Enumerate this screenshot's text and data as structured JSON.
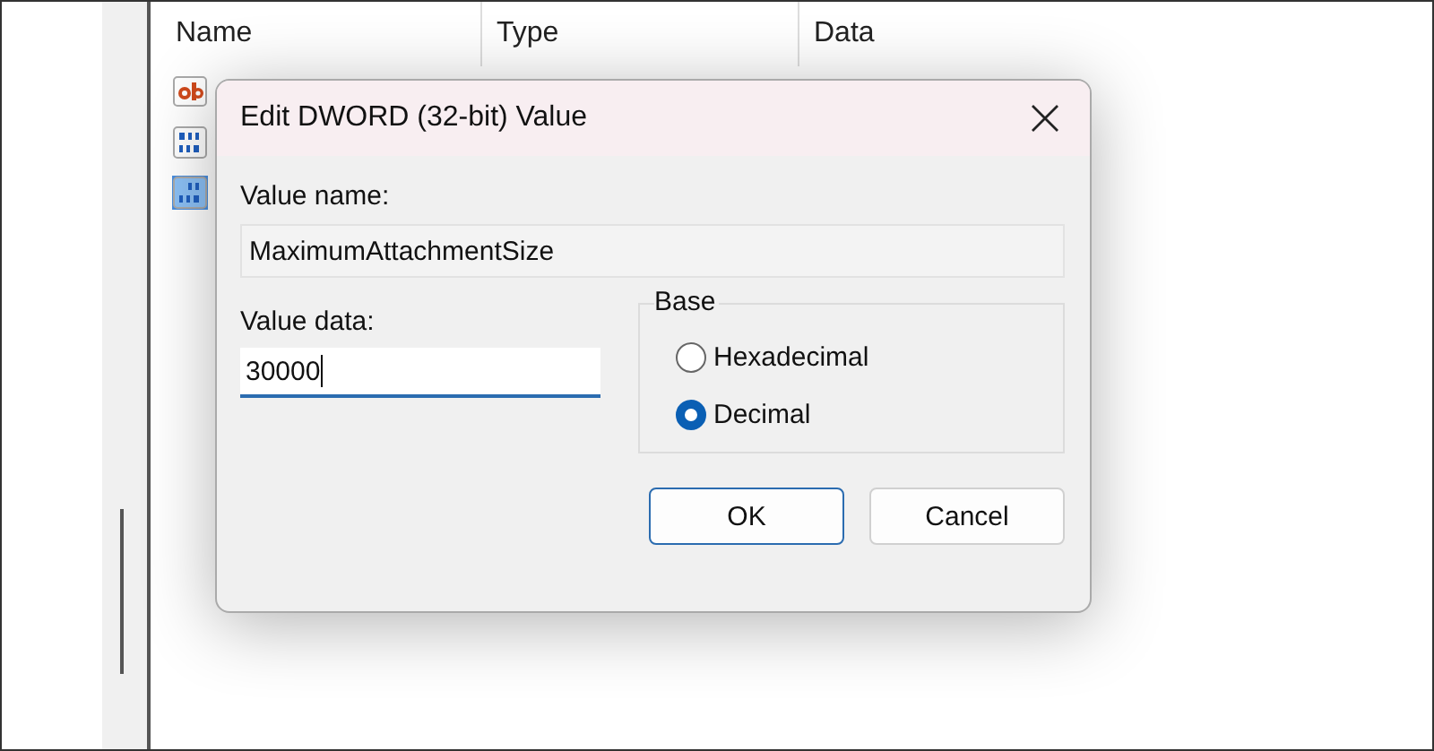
{
  "registry": {
    "columns": [
      "Name",
      "Type",
      "Data"
    ],
    "rows": [
      {
        "kind": "string",
        "selected": false
      },
      {
        "kind": "binary",
        "selected": false
      },
      {
        "kind": "binary",
        "selected": true
      }
    ]
  },
  "dialog": {
    "title": "Edit DWORD (32-bit) Value",
    "value_name_label": "Value name:",
    "value_name": "MaximumAttachmentSize",
    "value_data_label": "Value data:",
    "value_data": "30000",
    "base": {
      "label": "Base",
      "options": [
        {
          "label": "Hexadecimal",
          "selected": false
        },
        {
          "label": "Decimal",
          "selected": true
        }
      ]
    },
    "buttons": [
      "OK",
      "Cancel"
    ]
  }
}
